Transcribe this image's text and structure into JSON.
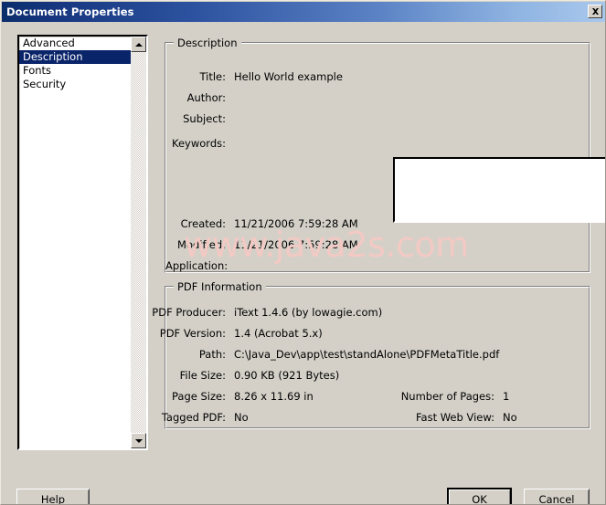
{
  "window": {
    "title": "Document Properties",
    "close_icon": "close-icon",
    "bg_color": "#d4d0c8",
    "titlebar_color": "#16357e",
    "selection_color": "#0a246a"
  },
  "sidebar": {
    "items": [
      {
        "label": "Advanced",
        "selected": false
      },
      {
        "label": "Description",
        "selected": true
      },
      {
        "label": "Fonts",
        "selected": false
      },
      {
        "label": "Security",
        "selected": false
      }
    ],
    "scroll_up_icon": "arrow-up-icon",
    "scroll_down_icon": "arrow-down-icon"
  },
  "description": {
    "group_title": "Description",
    "fields": [
      {
        "label": "Title:",
        "value": "Hello World example"
      },
      {
        "label": "Author:",
        "value": ""
      },
      {
        "label": "Subject:",
        "value": ""
      },
      {
        "label": "Keywords:",
        "value": ""
      },
      {
        "label": "Created:",
        "value": "11/21/2006 7:59:28 AM"
      },
      {
        "label": "Modified:",
        "value": "11/21/2006 7:59:28 AM"
      },
      {
        "label": "Application:",
        "value": ""
      }
    ],
    "keywords_value": "",
    "keywords_placeholder": ""
  },
  "pdf_information": {
    "group_title": "PDF Information",
    "fields": [
      {
        "label": "PDF Producer:",
        "value": "iText 1.4.6 (by lowagie.com)"
      },
      {
        "label": "PDF Version:",
        "value": "1.4 (Acrobat 5.x)"
      },
      {
        "label": "Path:",
        "value": "C:\\Java_Dev\\app\\test\\standAlone\\PDFMetaTitle.pdf"
      },
      {
        "label": "File Size:",
        "value": "0.90 KB (921 Bytes)"
      },
      {
        "label": "Page Size:",
        "value": "8.26 x 11.69 in"
      },
      {
        "label": "Tagged PDF:",
        "value": "No"
      }
    ],
    "right_fields": [
      {
        "label": "Number of Pages:",
        "value": "1"
      },
      {
        "label": "Fast Web View:",
        "value": "No"
      }
    ]
  },
  "buttons": {
    "help": "Help",
    "ok": "OK",
    "cancel": "Cancel"
  },
  "watermark": {
    "text": "www.java2s.com",
    "color": "#f3c9c4"
  }
}
